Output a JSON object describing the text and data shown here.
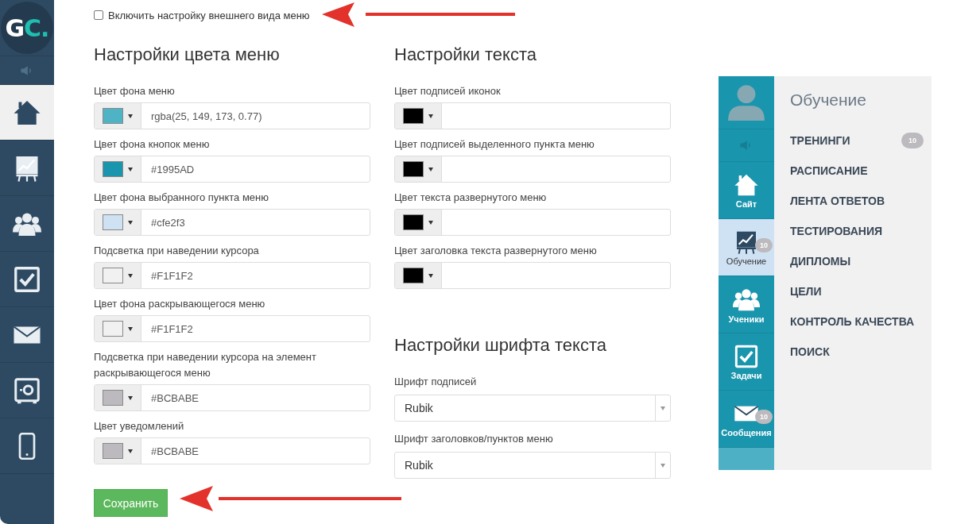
{
  "sidebar": {
    "logo": {
      "main": "G",
      "accent": "C."
    },
    "items": [
      {
        "kind": "speaker",
        "selected": false
      },
      {
        "kind": "home",
        "selected": true
      },
      {
        "kind": "chart",
        "selected": false
      },
      {
        "kind": "people",
        "selected": false
      },
      {
        "kind": "check",
        "selected": false
      },
      {
        "kind": "mail",
        "selected": false
      },
      {
        "kind": "safe",
        "selected": false
      },
      {
        "kind": "phone",
        "selected": false
      }
    ]
  },
  "enable_checkbox": {
    "label": "Включить настройку внешнего вида меню",
    "checked": false
  },
  "color_settings": {
    "title": "Настройки цвета меню",
    "fields": [
      {
        "label": "Цвет фона меню",
        "color": "#4fb3c6",
        "value": "rgba(25, 149, 173, 0.77)"
      },
      {
        "label": "Цвет фона кнопок меню",
        "color": "#1995ad",
        "value": "#1995AD"
      },
      {
        "label": "Цвет фона выбранного пункта меню",
        "color": "#cfe2f3",
        "value": "#cfe2f3"
      },
      {
        "label": "Подсветка при наведении курсора",
        "color": "#f1f1f2",
        "value": "#F1F1F2"
      },
      {
        "label": "Цвет фона раскрывающегося меню",
        "color": "#f1f1f2",
        "value": "#F1F1F2"
      },
      {
        "label": "Подсветка при наведении курсора на элемент раскрывающегося меню",
        "color": "#bcbabe",
        "value": "#BCBABE"
      },
      {
        "label": "Цвет уведомлений",
        "color": "#bcbabe",
        "value": "#BCBABE"
      }
    ]
  },
  "text_settings": {
    "title": "Настройки текста",
    "fields": [
      {
        "label": "Цвет подписей иконок",
        "color": "#000000"
      },
      {
        "label": "Цвет подписей выделенного пункта меню",
        "color": "#000000"
      },
      {
        "label": "Цвет текста развернутого меню",
        "color": "#000000"
      },
      {
        "label": "Цвет заголовка текста развернутого меню",
        "color": "#000000"
      }
    ]
  },
  "font_settings": {
    "title": "Настройки шрифта текста",
    "selects": [
      {
        "label": "Шрифт подписей",
        "value": "Rubik"
      },
      {
        "label": "Шрифт заголовков/пунктов меню",
        "value": "Rubik"
      }
    ]
  },
  "save_button": "Сохранить",
  "preview": {
    "icon_bar": [
      {
        "kind": "avatar"
      },
      {
        "kind": "speaker"
      },
      {
        "kind": "home",
        "label": "Сайт",
        "selected": false
      },
      {
        "kind": "chart",
        "label": "Обучение",
        "badge": "10",
        "selected": true
      },
      {
        "kind": "people",
        "label": "Ученики",
        "selected": false
      },
      {
        "kind": "check",
        "label": "Задачи",
        "selected": false
      },
      {
        "kind": "mail",
        "label": "Сообщения",
        "badge": "10",
        "selected": false
      }
    ],
    "menu": {
      "title": "Обучение",
      "items": [
        {
          "label": "ТРЕНИНГИ",
          "badge": "10"
        },
        {
          "label": "РАСПИСАНИЕ"
        },
        {
          "label": "ЛЕНТА ОТВЕТОВ"
        },
        {
          "label": "ТЕСТИРОВАНИЯ"
        },
        {
          "label": "ДИПЛОМЫ"
        },
        {
          "label": "ЦЕЛИ"
        },
        {
          "label": "КОНТРОЛЬ КАЧЕСТВА"
        },
        {
          "label": "ПОИСК"
        }
      ]
    }
  }
}
